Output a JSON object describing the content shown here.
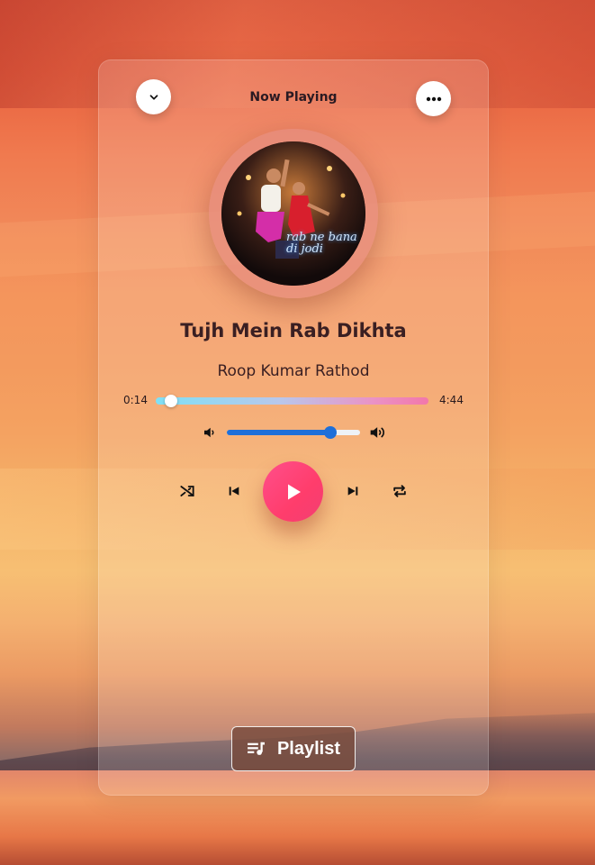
{
  "header": {
    "title": "Now Playing",
    "collapse_icon": "chevron-down-icon",
    "more_icon": "more-horizontal-icon"
  },
  "track": {
    "title": "Tujh Mein Rab Dikhta",
    "artist": "Roop Kumar Rathod",
    "album_art_text": "rab ne bana di jodi"
  },
  "progress": {
    "current_time": "0:14",
    "duration": "4:44",
    "fraction": 0.05
  },
  "volume": {
    "level": 0.78,
    "min_icon": "volume-low-icon",
    "max_icon": "volume-high-icon"
  },
  "controls": {
    "shuffle_icon": "shuffle-icon",
    "previous_icon": "skip-previous-icon",
    "play_icon": "play-icon",
    "next_icon": "skip-next-icon",
    "repeat_icon": "repeat-icon"
  },
  "playlist": {
    "label": "Playlist",
    "icon": "playlist-music-icon"
  },
  "colors": {
    "play_button": "#ff3d6c",
    "volume_accent": "#1e6fd9",
    "progress_start": "#7fe0f5",
    "progress_end": "#f277aa"
  }
}
